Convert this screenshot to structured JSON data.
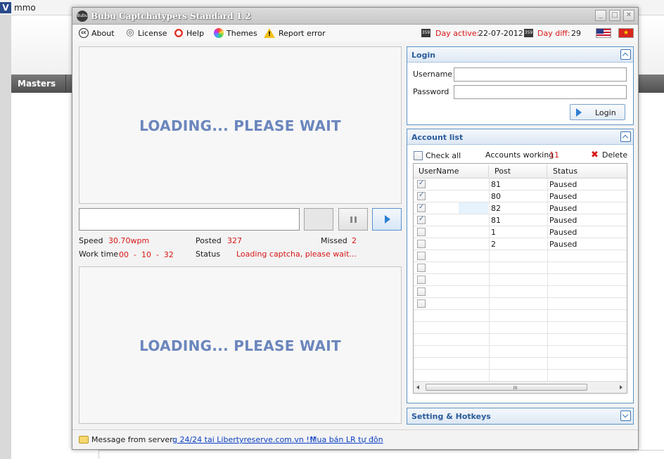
{
  "background": {
    "site_title": "mmo",
    "logo_glyph": "V",
    "nav_masters": "Masters"
  },
  "window": {
    "title": "Bubu Captchatypers Standard 1.2",
    "logo_text": "Bubu"
  },
  "menu": {
    "about": "About",
    "license": "License",
    "help": "Help",
    "themes": "Themes",
    "report_error": "Report error",
    "cc_glyph": "cc"
  },
  "day": {
    "calendar_glyph": "359",
    "active_label": "Day active:",
    "active_value": "22-07-2012",
    "diff_label": "Day diff:",
    "diff_value": "29"
  },
  "flag_vn_glyph": "★",
  "captcha": {
    "loading_top": "LOADING... PLEASE WAIT",
    "loading_bottom": "LOADING... PLEASE WAIT",
    "answer_value": ""
  },
  "stats": {
    "speed_label": "Speed",
    "speed_value": "30.70wpm",
    "posted_label": "Posted",
    "posted_value": "327",
    "missed_label": "Missed",
    "missed_value": "2",
    "worktime_label": "Work time",
    "worktime_value": "00  -  10  -  32",
    "status_label": "Status",
    "status_value": "Loading captcha, please wait..."
  },
  "login": {
    "title": "Login",
    "username_label": "Username",
    "password_label": "Password",
    "username_value": "",
    "password_value": "",
    "button_label": "Login"
  },
  "accounts": {
    "title": "Account list",
    "check_all": "Check all",
    "working_label": "Accounts working",
    "working_value": "11",
    "delete_label": "Delete",
    "delete_glyph": "✖",
    "columns": [
      "UserName",
      "Post",
      "Status"
    ],
    "rows": [
      {
        "checked": true,
        "post": "81",
        "status": "Paused"
      },
      {
        "checked": true,
        "post": "80",
        "status": "Paused"
      },
      {
        "checked": true,
        "post": "82",
        "status": "Paused"
      },
      {
        "checked": true,
        "post": "81",
        "status": "Paused"
      },
      {
        "checked": false,
        "post": "1",
        "status": "Paused"
      },
      {
        "checked": false,
        "post": "2",
        "status": "Paused"
      }
    ]
  },
  "settings": {
    "title": "Setting & Hotkeys"
  },
  "statusbar": {
    "message_label": "Message from server:",
    "link1": "g 24/24 tai Libertyreserve.com.vn !!!",
    "link2": "Mua bán LR tự đôn"
  },
  "colors": {
    "accent_blue": "#2b5c9a",
    "loading_text": "#6b86bd",
    "value_red": "#d81616",
    "link_blue": "#0b3fc4"
  }
}
